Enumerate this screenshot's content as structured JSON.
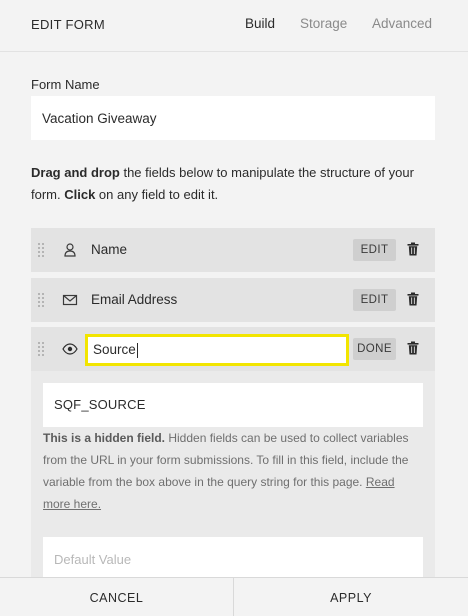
{
  "header": {
    "title": "EDIT FORM",
    "tabs": [
      {
        "label": "Build",
        "active": true
      },
      {
        "label": "Storage",
        "active": false
      },
      {
        "label": "Advanced",
        "active": false
      }
    ]
  },
  "form": {
    "name_label": "Form Name",
    "name_value": "Vacation Giveaway",
    "instructions": {
      "bold1": "Drag and drop",
      "text1": " the fields below to manipulate the structure of your form. ",
      "bold2": "Click",
      "text2": " on any field to edit it."
    }
  },
  "fields": [
    {
      "label": "Name",
      "icon": "person-icon",
      "action": "EDIT"
    },
    {
      "label": "Email Address",
      "icon": "envelope-icon",
      "action": "EDIT"
    },
    {
      "label": "Source",
      "icon": "eye-icon",
      "action": "DONE"
    }
  ],
  "hidden_field": {
    "variable": "SQF_SOURCE",
    "note_bold": "This is a hidden field.",
    "note_text": " Hidden fields can be used to collect variables from the URL in your form submissions. To fill in this field, include the variable from the box above in the query string for this page. ",
    "read_more": "Read more here.",
    "default_placeholder": "Default Value"
  },
  "footer": {
    "cancel": "CANCEL",
    "apply": "APPLY"
  },
  "colors": {
    "focus_border": "#f2e500",
    "field_row_bg": "#e3e3e3",
    "panel_bg": "#f3f3f3"
  }
}
